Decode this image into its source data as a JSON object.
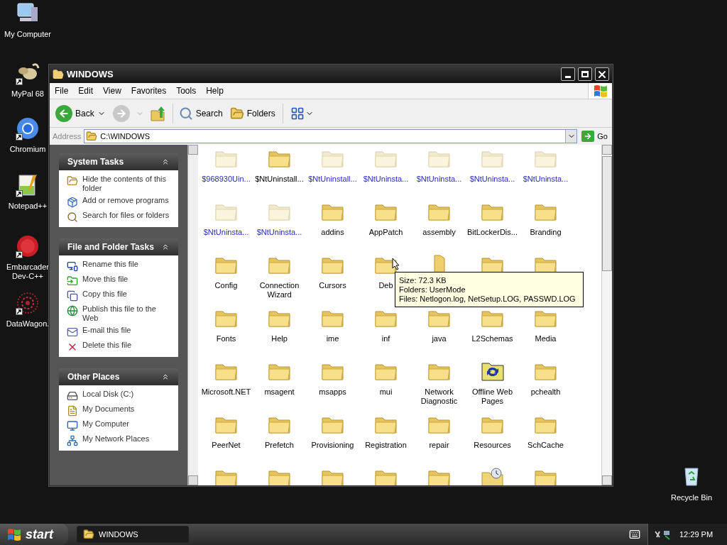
{
  "desktop_icons": [
    {
      "label": "My Computer",
      "kind": "computer"
    },
    {
      "label": "MyPal 68",
      "kind": "animal"
    },
    {
      "label": "Chromium",
      "kind": "browser"
    },
    {
      "label": "Notepad++",
      "kind": "notepad"
    },
    {
      "label": "Embarcader\nDev-C++",
      "kind": "ide"
    },
    {
      "label": "DataWagon.",
      "kind": "web"
    }
  ],
  "recycle_bin": {
    "label": "Recycle Bin"
  },
  "window": {
    "title": "WINDOWS",
    "menu": [
      "File",
      "Edit",
      "View",
      "Favorites",
      "Tools",
      "Help"
    ],
    "toolbar": {
      "back": "Back",
      "search": "Search",
      "folders": "Folders"
    },
    "address": {
      "label": "Address",
      "value": "C:\\WINDOWS",
      "go": "Go"
    },
    "task_panels": [
      {
        "title": "System Tasks",
        "items": [
          {
            "text": "Hide the contents of this folder",
            "kind": "folder"
          },
          {
            "text": "Add or remove programs",
            "kind": "package"
          },
          {
            "text": "Search for files or folders",
            "kind": "search"
          }
        ]
      },
      {
        "title": "File and Folder Tasks",
        "items": [
          {
            "text": "Rename this file",
            "kind": "rename"
          },
          {
            "text": "Move this file",
            "kind": "move"
          },
          {
            "text": "Copy this file",
            "kind": "copy"
          },
          {
            "text": "Publish this file to the Web",
            "kind": "globe"
          },
          {
            "text": "E-mail this file",
            "kind": "mail"
          },
          {
            "text": "Delete this file",
            "kind": "delete"
          }
        ]
      },
      {
        "title": "Other Places",
        "items": [
          {
            "text": "Local Disk (C:)",
            "kind": "disk"
          },
          {
            "text": "My Documents",
            "kind": "documents"
          },
          {
            "text": "My Computer",
            "kind": "computer"
          },
          {
            "text": "My Network Places",
            "kind": "network"
          }
        ]
      }
    ],
    "items": [
      {
        "label": "$968930Uin...",
        "kind": "folder",
        "hidden": true
      },
      {
        "label": "$NtUninstall...",
        "kind": "folder",
        "hidden": false
      },
      {
        "label": "$NtUninstall...",
        "kind": "folder",
        "hidden": true
      },
      {
        "label": "$NtUninsta...",
        "kind": "folder",
        "hidden": true
      },
      {
        "label": "$NtUninsta...",
        "kind": "folder",
        "hidden": true
      },
      {
        "label": "$NtUninsta...",
        "kind": "folder",
        "hidden": true
      },
      {
        "label": "$NtUninsta...",
        "kind": "folder",
        "hidden": true
      },
      {
        "label": "$NtUninsta...",
        "kind": "folder",
        "hidden": true
      },
      {
        "label": "$NtUninsta...",
        "kind": "folder",
        "hidden": true
      },
      {
        "label": "addins",
        "kind": "folder",
        "hidden": false
      },
      {
        "label": "AppPatch",
        "kind": "folder",
        "hidden": false
      },
      {
        "label": "assembly",
        "kind": "folder",
        "hidden": false
      },
      {
        "label": "BitLockerDis...",
        "kind": "folder",
        "hidden": false
      },
      {
        "label": "Branding",
        "kind": "folder",
        "hidden": false
      },
      {
        "label": "Config",
        "kind": "folder",
        "hidden": false
      },
      {
        "label": "Connection Wizard",
        "kind": "folder",
        "hidden": false
      },
      {
        "label": "Cursors",
        "kind": "folder",
        "hidden": false
      },
      {
        "label": "Deb",
        "kind": "folder",
        "hidden": false
      },
      {
        "kind": "standing",
        "hidden": false
      },
      {
        "kind": "folder",
        "hidden": false
      },
      {
        "kind": "folder",
        "hidden": false
      },
      {
        "label": "Fonts",
        "kind": "folder",
        "hidden": false
      },
      {
        "label": "Help",
        "kind": "folder",
        "hidden": false
      },
      {
        "label": "ime",
        "kind": "folder",
        "hidden": false
      },
      {
        "label": "inf",
        "kind": "folder",
        "hidden": false
      },
      {
        "label": "java",
        "kind": "folder",
        "hidden": false
      },
      {
        "label": "L2Schemas",
        "kind": "folder",
        "hidden": false
      },
      {
        "label": "Media",
        "kind": "folder",
        "hidden": false
      },
      {
        "label": "Microsoft.NET",
        "kind": "folder",
        "hidden": false
      },
      {
        "label": "msagent",
        "kind": "folder",
        "hidden": false
      },
      {
        "label": "msapps",
        "kind": "folder",
        "hidden": false
      },
      {
        "label": "mui",
        "kind": "folder",
        "hidden": false
      },
      {
        "label": "Network Diagnostic",
        "kind": "folder",
        "hidden": false
      },
      {
        "label": "Offline Web Pages",
        "kind": "sync",
        "hidden": false
      },
      {
        "label": "pchealth",
        "kind": "folder",
        "hidden": false
      },
      {
        "label": "PeerNet",
        "kind": "folder",
        "hidden": false
      },
      {
        "label": "Prefetch",
        "kind": "folder",
        "hidden": false
      },
      {
        "label": "Provisioning",
        "kind": "folder",
        "hidden": false
      },
      {
        "label": "Registration",
        "kind": "folder",
        "hidden": false
      },
      {
        "label": "repair",
        "kind": "folder",
        "hidden": false
      },
      {
        "label": "Resources",
        "kind": "folder",
        "hidden": false
      },
      {
        "label": "SchCache",
        "kind": "folder",
        "hidden": false
      },
      {
        "kind": "folder",
        "hidden": false
      },
      {
        "kind": "folder",
        "hidden": false
      },
      {
        "kind": "folder",
        "hidden": false
      },
      {
        "kind": "folder",
        "hidden": false
      },
      {
        "kind": "folder",
        "hidden": false
      },
      {
        "kind": "scheduled",
        "hidden": false
      },
      {
        "kind": "folder",
        "hidden": false
      }
    ],
    "tooltip": [
      "Size: 72.3 KB",
      "Folders: UserMode",
      "Files: Netlogon.log, NetSetup.LOG, PASSWD.LOG"
    ]
  },
  "taskbar": {
    "start": "start",
    "tasks": [
      {
        "label": "WINDOWS"
      }
    ],
    "clock": "12:29 PM"
  }
}
